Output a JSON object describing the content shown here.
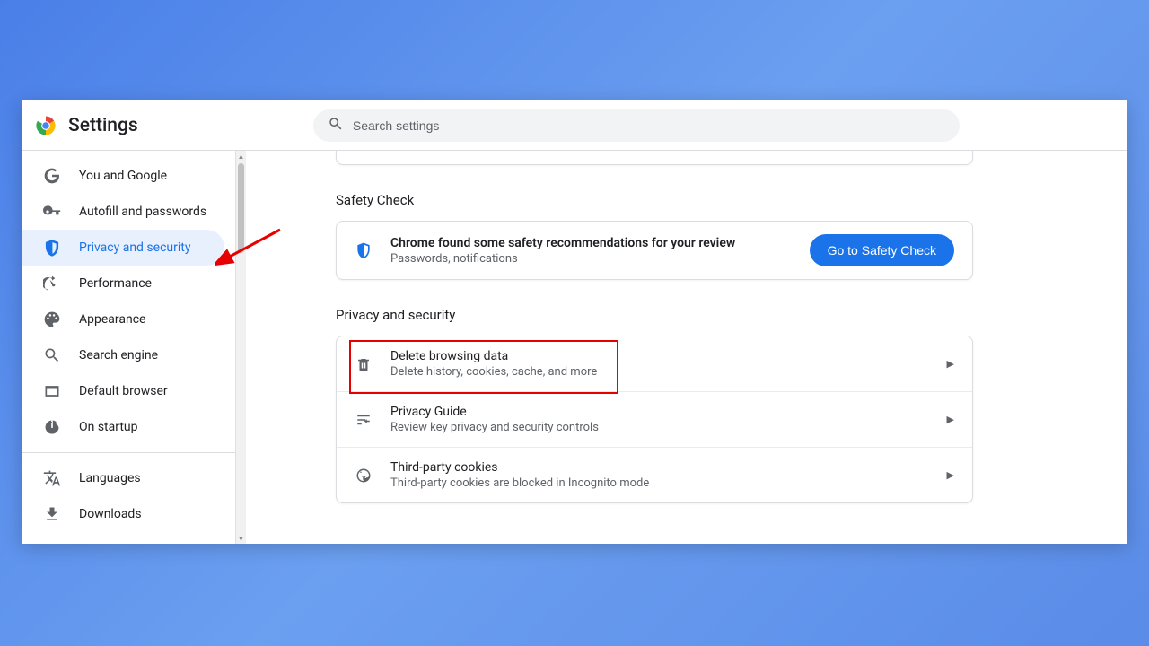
{
  "app": {
    "title": "Settings"
  },
  "search": {
    "placeholder": "Search settings"
  },
  "sidebar": {
    "items": [
      {
        "id": "you-and-google",
        "label": "You and Google"
      },
      {
        "id": "autofill",
        "label": "Autofill and passwords"
      },
      {
        "id": "privacy",
        "label": "Privacy and security",
        "active": true
      },
      {
        "id": "performance",
        "label": "Performance"
      },
      {
        "id": "appearance",
        "label": "Appearance"
      },
      {
        "id": "search-engine",
        "label": "Search engine"
      },
      {
        "id": "default-browser",
        "label": "Default browser"
      },
      {
        "id": "on-startup",
        "label": "On startup"
      }
    ],
    "secondary": [
      {
        "id": "languages",
        "label": "Languages"
      },
      {
        "id": "downloads",
        "label": "Downloads"
      }
    ]
  },
  "sections": {
    "safety_check": {
      "heading": "Safety Check",
      "title": "Chrome found some safety recommendations for your review",
      "subtitle": "Passwords, notifications",
      "button": "Go to Safety Check"
    },
    "privacy": {
      "heading": "Privacy and security",
      "rows": [
        {
          "id": "delete-browsing-data",
          "title": "Delete browsing data",
          "subtitle": "Delete history, cookies, cache, and more",
          "highlighted": true
        },
        {
          "id": "privacy-guide",
          "title": "Privacy Guide",
          "subtitle": "Review key privacy and security controls"
        },
        {
          "id": "third-party-cookies",
          "title": "Third-party cookies",
          "subtitle": "Third-party cookies are blocked in Incognito mode"
        }
      ]
    }
  },
  "colors": {
    "accent": "#1a73e8",
    "highlight": "#e60000"
  }
}
